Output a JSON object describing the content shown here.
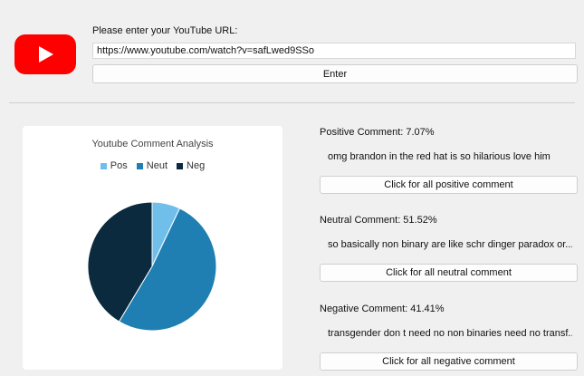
{
  "header": {
    "prompt": "Please enter your YouTube URL:",
    "url_value": "https://www.youtube.com/watch?v=safLwed9SSo",
    "enter_label": "Enter"
  },
  "chart_data": {
    "type": "pie",
    "title": "Youtube Comment Analysis",
    "categories": [
      "Pos",
      "Neut",
      "Neg"
    ],
    "values": [
      7.07,
      51.52,
      41.41
    ],
    "colors": [
      "#6fbfea",
      "#1f7fb2",
      "#0b2a3e"
    ],
    "legend_position": "top"
  },
  "sections": {
    "positive": {
      "title": "Positive Comment: 7.07%",
      "comment": "omg brandon in the red hat is so hilarious love him",
      "button": "Click for all positive comment"
    },
    "neutral": {
      "title": "Neutral Comment: 51.52%",
      "comment": "so basically non binary are like schr dinger paradox or...",
      "button": "Click for all neutral comment"
    },
    "negative": {
      "title": "Negative Comment: 41.41%",
      "comment": "transgender don t need no non binaries need no transf...",
      "button": "Click for all negative comment"
    }
  },
  "icons": {
    "logo": "youtube-logo-icon"
  }
}
